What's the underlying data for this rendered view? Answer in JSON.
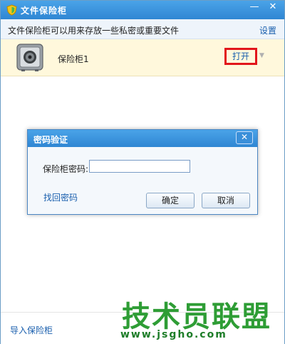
{
  "window": {
    "title": "文件保险柜",
    "minimize_glyph": "—",
    "close_glyph": "✕"
  },
  "infobar": {
    "text": "文件保险柜可以用来存放一些私密或重要文件",
    "settings_label": "设置"
  },
  "vault": {
    "icon": "safe-icon",
    "name": "保险柜1",
    "open_label": "打开",
    "dropdown_glyph": "▼"
  },
  "dialog": {
    "title": "密码验证",
    "close_glyph": "✕",
    "password_label": "保险柜密码:",
    "password_value": "",
    "recover_label": "找回密码",
    "ok_label": "确定",
    "cancel_label": "取消"
  },
  "footer": {
    "import_label": "导入保险柜"
  },
  "watermark": {
    "title": "技术员联盟",
    "url": "www.jsgho.com"
  },
  "colors": {
    "titlebar": "#2f86d3",
    "link": "#1a5fae",
    "highlight_border": "#e2161b",
    "vault_row_bg": "#fff8dc",
    "watermark": "#2e9d35"
  }
}
